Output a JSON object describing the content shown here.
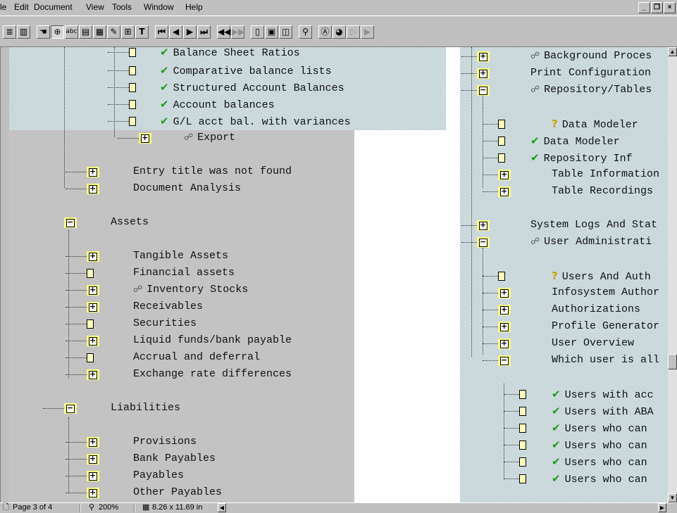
{
  "menu": {
    "file": "le",
    "edit": "Edit",
    "document": "Document",
    "view": "View",
    "tools": "Tools",
    "window": "Window",
    "help": "Help"
  },
  "window_controls": {
    "minimize": "_",
    "restore": "❐",
    "close": "×"
  },
  "toolbar": {
    "text_tool": "T",
    "find_icon": "binoculars-icon",
    "hand_icon": "hand-icon",
    "zoom_icon": "zoom-in-icon"
  },
  "left_tree": [
    {
      "text": "Balance Sheet Ratios",
      "icon": "check"
    },
    {
      "text": "Comparative balance lists",
      "icon": "check"
    },
    {
      "text": "Structured Account Balances",
      "icon": "check"
    },
    {
      "text": "Account balances",
      "icon": "check"
    },
    {
      "text": "G/L acct bal. with variances",
      "icon": "check"
    },
    {
      "text": "Export",
      "icon": "link"
    },
    {
      "text": "Entry title was not found",
      "icon": ""
    },
    {
      "text": "Document Analysis",
      "icon": ""
    },
    {
      "text": "Assets",
      "icon": ""
    },
    {
      "text": "Tangible Assets",
      "icon": ""
    },
    {
      "text": "Financial assets",
      "icon": ""
    },
    {
      "text": "Inventory Stocks",
      "icon": "link"
    },
    {
      "text": "Receivables",
      "icon": ""
    },
    {
      "text": "Securities",
      "icon": ""
    },
    {
      "text": "Liquid funds/bank payable",
      "icon": ""
    },
    {
      "text": "Accrual and deferral",
      "icon": ""
    },
    {
      "text": "Exchange rate differences",
      "icon": ""
    },
    {
      "text": "Liabilities",
      "icon": ""
    },
    {
      "text": "Provisions",
      "icon": ""
    },
    {
      "text": "Bank Payables",
      "icon": ""
    },
    {
      "text": "Payables",
      "icon": ""
    },
    {
      "text": "Other Payables",
      "icon": ""
    }
  ],
  "right_tree": [
    {
      "text": "Background Proces",
      "icon": "link"
    },
    {
      "text": "Print Configuration",
      "icon": ""
    },
    {
      "text": "Repository/Tables",
      "icon": "link"
    },
    {
      "text": "Data Modeler",
      "icon": "question"
    },
    {
      "text": "Data Modeler",
      "icon": "check"
    },
    {
      "text": "Repository Inf",
      "icon": "check"
    },
    {
      "text": "Table Information",
      "icon": ""
    },
    {
      "text": "Table Recordings",
      "icon": ""
    },
    {
      "text": "System Logs And Stat",
      "icon": ""
    },
    {
      "text": "User Administrati",
      "icon": "link"
    },
    {
      "text": "Users And Auth",
      "icon": "question"
    },
    {
      "text": "Infosystem Author",
      "icon": ""
    },
    {
      "text": "Authorizations",
      "icon": ""
    },
    {
      "text": "Profile Generator",
      "icon": ""
    },
    {
      "text": "User Overview",
      "icon": ""
    },
    {
      "text": "Which user is all",
      "icon": ""
    },
    {
      "text": "Users with acc",
      "icon": "check"
    },
    {
      "text": "Users with ABA",
      "icon": "check"
    },
    {
      "text": "Users who can",
      "icon": "check"
    },
    {
      "text": "Users who can",
      "icon": "check"
    },
    {
      "text": "Users who can",
      "icon": "check"
    },
    {
      "text": "Users who can",
      "icon": "check"
    }
  ],
  "status": {
    "page": "Page 3 of 4",
    "zoom": "200%",
    "size": "8.26 x 11.69 in"
  },
  "colors": {
    "highlight": "#cfdde0",
    "folder": "#ffff80",
    "check": "#1c9d1c"
  }
}
